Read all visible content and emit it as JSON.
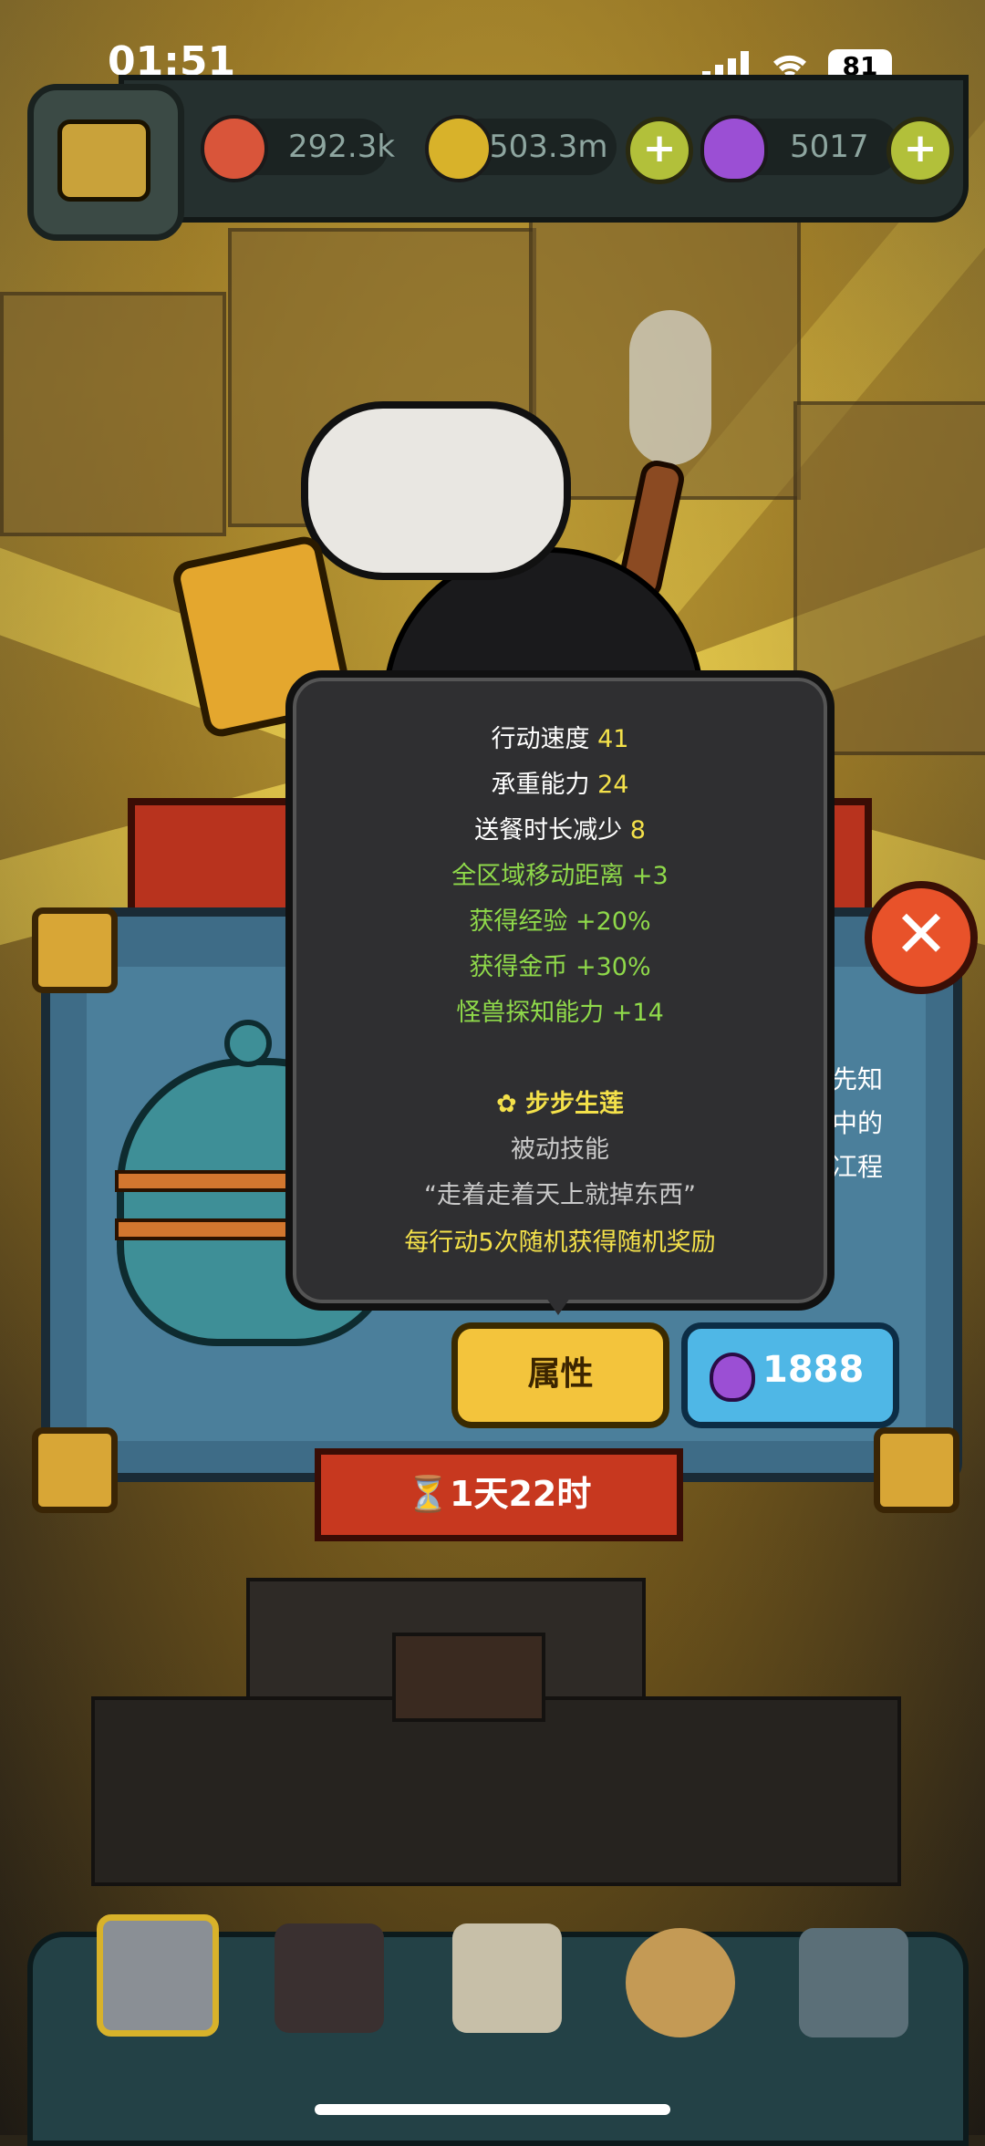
{
  "status_bar": {
    "time": "01:51",
    "battery": "81"
  },
  "resources": [
    {
      "name": "eyeball-currency",
      "value": "292.3k",
      "color": "#d9553a"
    },
    {
      "name": "gold-coin",
      "value": "503.3m",
      "color": "#d8b22a"
    },
    {
      "name": "purple-potion",
      "value": "5017",
      "color": "#9b4fd4"
    }
  ],
  "tooltip": {
    "stats": [
      {
        "label": "行动速度",
        "value": "41"
      },
      {
        "label": "承重能力",
        "value": "24"
      },
      {
        "label": "送餐时长减少",
        "value": "8"
      }
    ],
    "bonuses": [
      "全区域移动距离 +3",
      "获得经验 +20%",
      "获得金币 +30%",
      "怪兽探知能力 +14"
    ],
    "skill": {
      "name": "步步生莲",
      "type": "被动技能",
      "quote": "“走着走着天上就掉东西”",
      "effect": "每行动5次随机获得随机奖励"
    }
  },
  "panel": {
    "side_text": [
      "先知",
      "中的",
      "冮程"
    ],
    "attributes_button": "属性",
    "price": "1888",
    "timer": "1天22时",
    "close_symbol": "✕"
  }
}
